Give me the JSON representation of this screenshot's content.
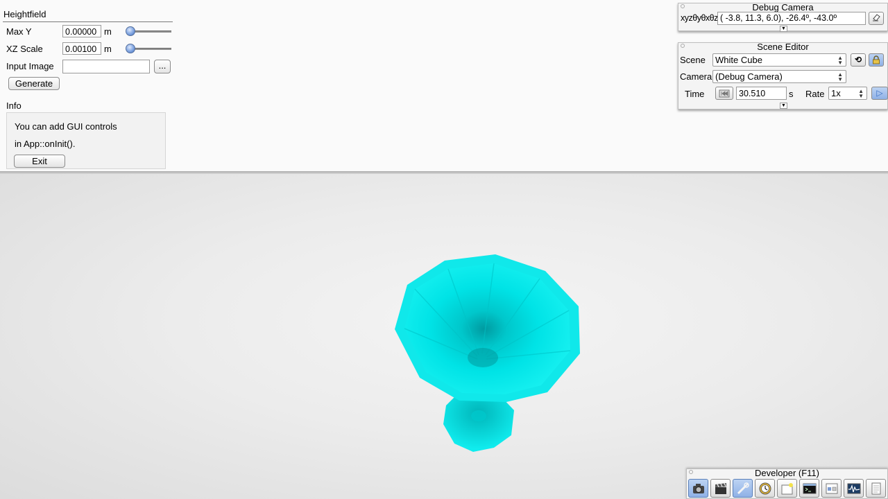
{
  "heightfield": {
    "title": "Heightfield",
    "max_y": {
      "label": "Max Y",
      "value": "0.00000",
      "unit": "m",
      "slider_fraction": 0.0
    },
    "xz_scale": {
      "label": "XZ Scale",
      "value": "0.00100",
      "unit": "m",
      "slider_fraction": 0.0
    },
    "input_image": {
      "label": "Input Image",
      "value": "",
      "browse_label": "..."
    },
    "generate_label": "Generate"
  },
  "info": {
    "title": "Info",
    "line1": "You can add GUI controls",
    "line2": "in App::onInit().",
    "exit_label": "Exit"
  },
  "debug_camera": {
    "title": "Debug Camera",
    "coord_label": "xyzθyθxθz",
    "coord_value": "( -3.8,  11.3,   6.0), -26.4º, -43.0º"
  },
  "scene_editor": {
    "title": "Scene Editor",
    "scene_label": "Scene",
    "scene_value": "White Cube",
    "camera_label": "Camera",
    "camera_value": "(Debug Camera)",
    "time_label": "Time",
    "time_value": "30.510",
    "time_unit": "s",
    "rate_label": "Rate",
    "rate_value": "1x"
  },
  "developer": {
    "title": "Developer (F11)",
    "tools": [
      "camera-icon",
      "clapperboard-icon",
      "tools-icon",
      "clock-icon",
      "new-window-icon",
      "console-icon",
      "scene-graph-icon",
      "profiler-icon",
      "document-icon"
    ]
  },
  "colors": {
    "object": "#00e5e8",
    "accent": "#3f6fc2"
  }
}
